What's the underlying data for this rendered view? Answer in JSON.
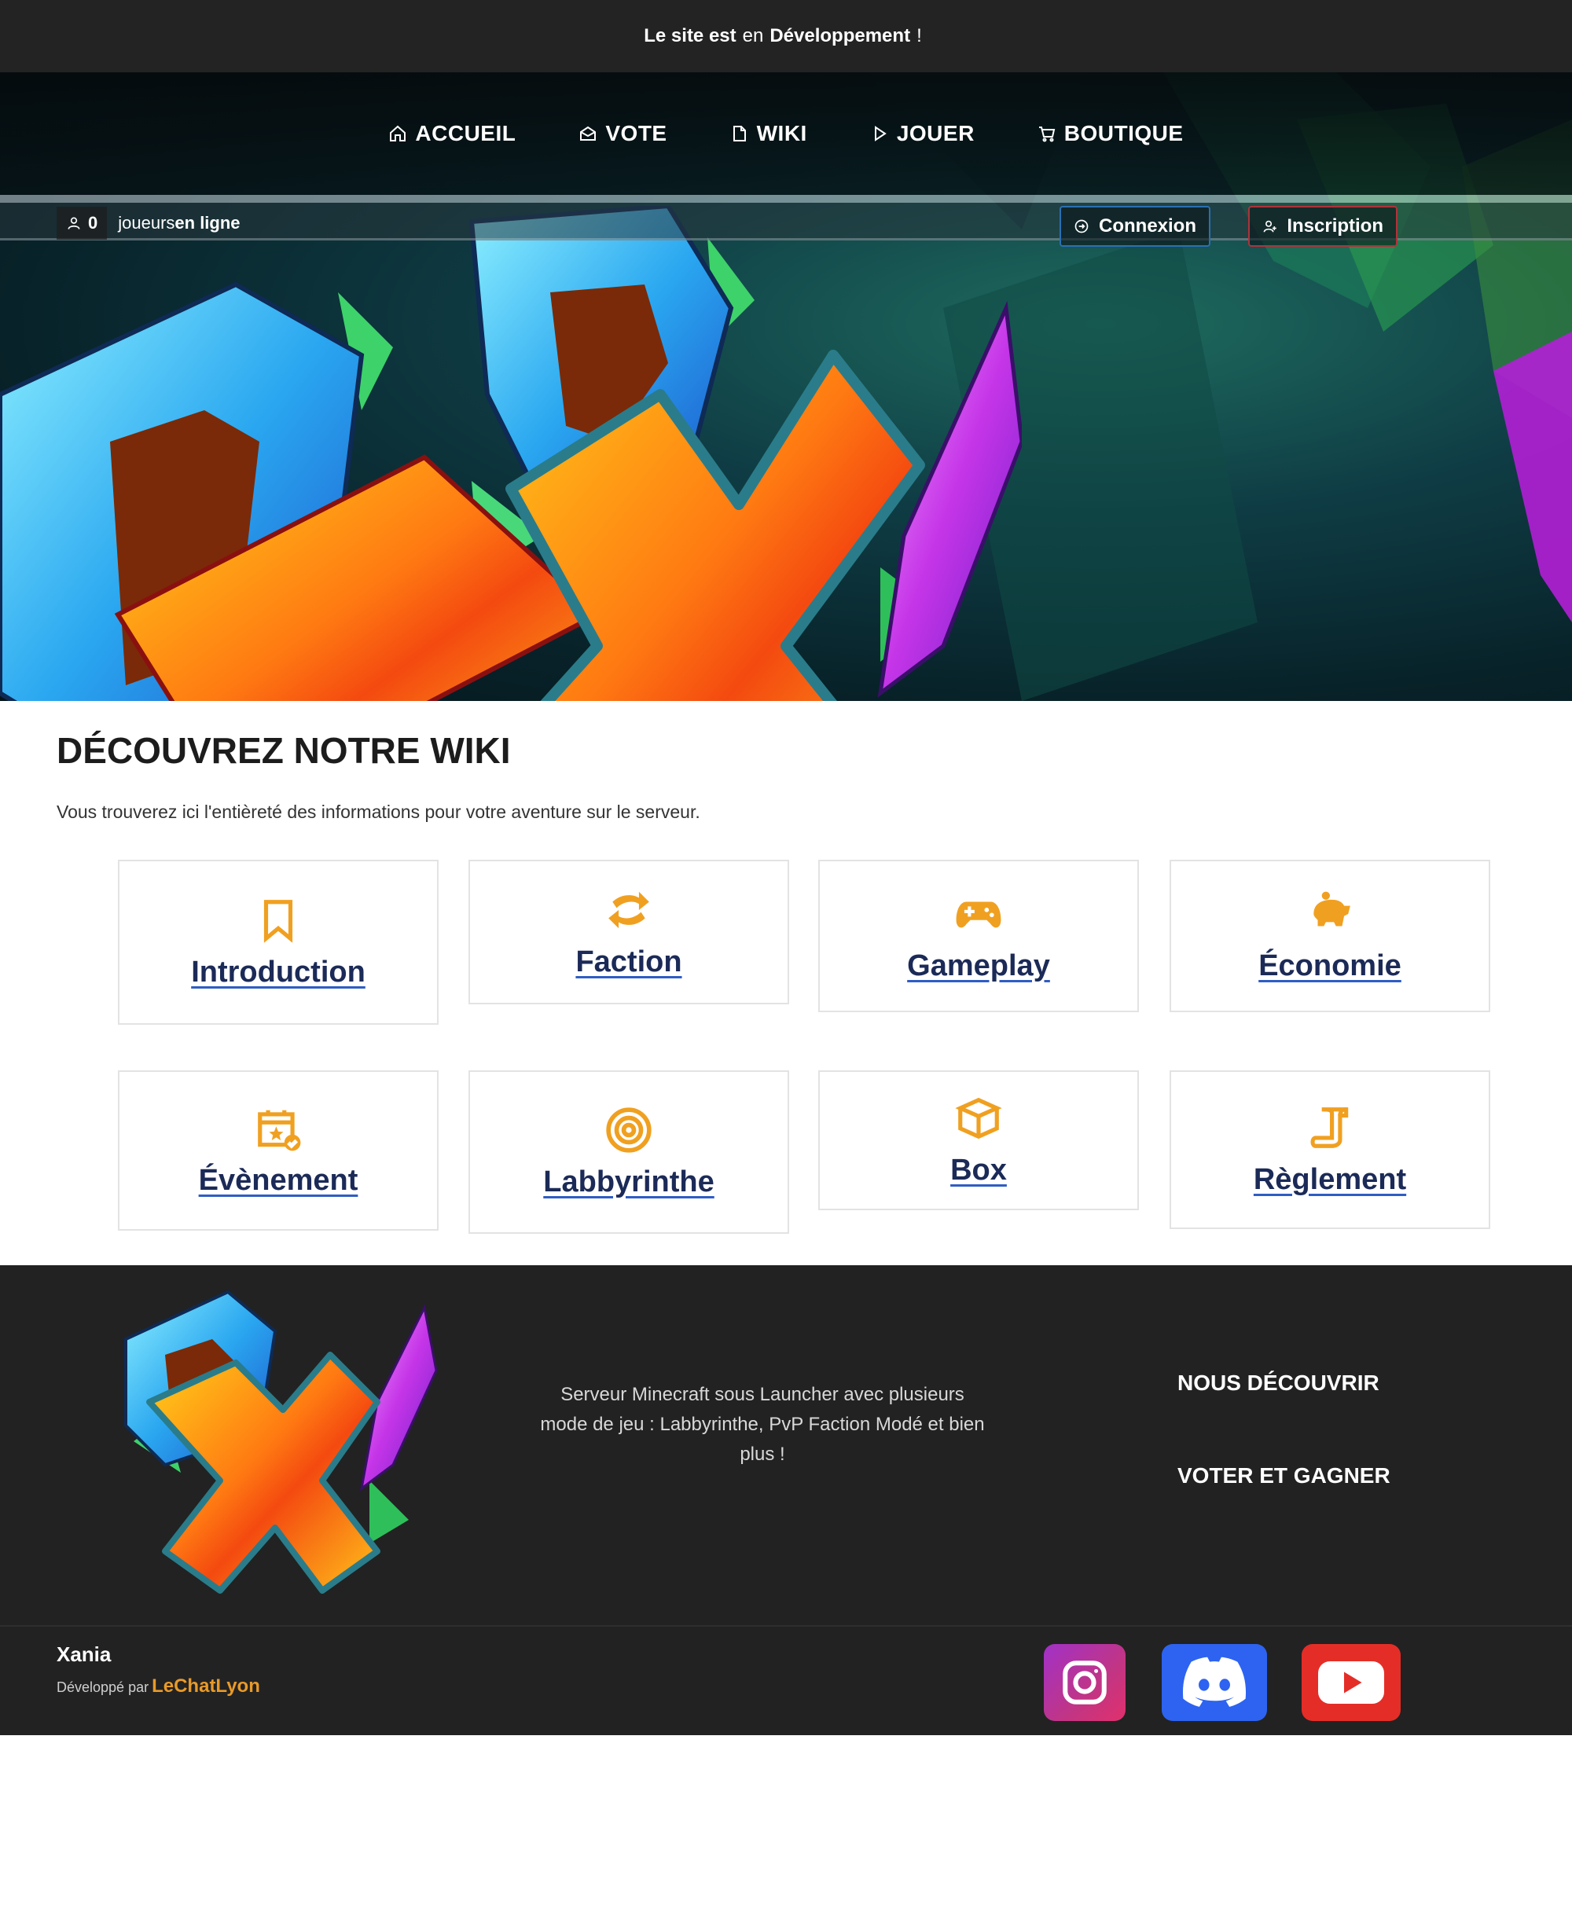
{
  "devbar": {
    "part1": "Le site est",
    "part2": "en",
    "part3": "Développement",
    "part4": "!"
  },
  "nav": [
    {
      "label": "ACCUEIL",
      "icon": "home-icon"
    },
    {
      "label": "VOTE",
      "icon": "vote-icon"
    },
    {
      "label": "WIKI",
      "icon": "document-icon"
    },
    {
      "label": "JOUER",
      "icon": "play-icon"
    },
    {
      "label": "BOUTIQUE",
      "icon": "cart-icon"
    }
  ],
  "online": {
    "count": "0",
    "label_a": "joueurs",
    "label_b": "en ligne"
  },
  "auth": {
    "login": "Connexion",
    "register": "Inscription"
  },
  "wiki": {
    "title": "DÉCOUVREZ NOTRE WIKI",
    "description": "Vous trouverez ici l'entièreté des informations pour votre aventure sur le serveur.",
    "cards": [
      {
        "label": "Introduction",
        "icon": "bookmark-icon"
      },
      {
        "label": "Faction",
        "icon": "swap-icon"
      },
      {
        "label": "Gameplay",
        "icon": "gamepad-icon"
      },
      {
        "label": "Économie",
        "icon": "piggy-bank-icon"
      },
      {
        "label": "Évènement",
        "icon": "calendar-check-icon"
      },
      {
        "label": "Labbyrinthe",
        "icon": "target-icon"
      },
      {
        "label": "Box",
        "icon": "box-icon"
      },
      {
        "label": "Règlement",
        "icon": "scroll-icon"
      }
    ]
  },
  "footer": {
    "description": "Serveur Minecraft sous Launcher avec plusieurs mode de jeu : Labbyrinthe, PvP Faction Modé et bien plus !",
    "links": [
      "NOUS DÉCOUVRIR",
      "VOTER ET GAGNER"
    ],
    "brand": "Xania",
    "developed_by": "Développé par",
    "author": "LeChatLyon"
  },
  "colors": {
    "accent": "#f0a020",
    "card_label": "#1b2a57",
    "footer_bg": "#222222",
    "devbar_bg": "#232323"
  }
}
